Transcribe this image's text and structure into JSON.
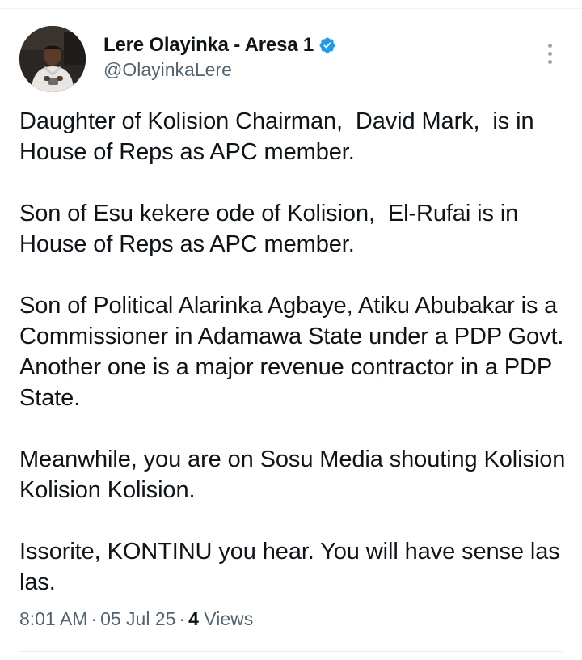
{
  "tweet": {
    "author": {
      "display_name": "Lere Olayinka - Aresa 1",
      "handle": "@OlayinkaLere",
      "verified": true,
      "verified_badge_color": "#1d9bf0"
    },
    "paragraphs": [
      "Daughter of Kolision Chairman,  David Mark,  is in House of Reps as APC member.",
      "Son of Esu kekere ode of Kolision,  El-Rufai is in House of Reps as APC member.",
      "Son of Political Alarinka Agbaye, Atiku Abubakar is a Commissioner in Adamawa State under a PDP Govt. Another one is a major revenue contractor in a PDP State.",
      "Meanwhile, you are on Sosu Media shouting Kolision Kolision Kolision.",
      "Issorite, KONTINU you hear. You will have sense las las."
    ],
    "meta": {
      "time": "8:01 AM",
      "separator": "·",
      "date": "05 Jul 25",
      "views_count": "4",
      "views_label": "Views"
    }
  },
  "icons": {
    "avatar": "profile-photo",
    "verified": "verified-badge-icon",
    "more": "more-options-icon"
  },
  "colors": {
    "text_primary": "#0f1419",
    "text_secondary": "#536471",
    "divider": "#e6ecf0"
  }
}
